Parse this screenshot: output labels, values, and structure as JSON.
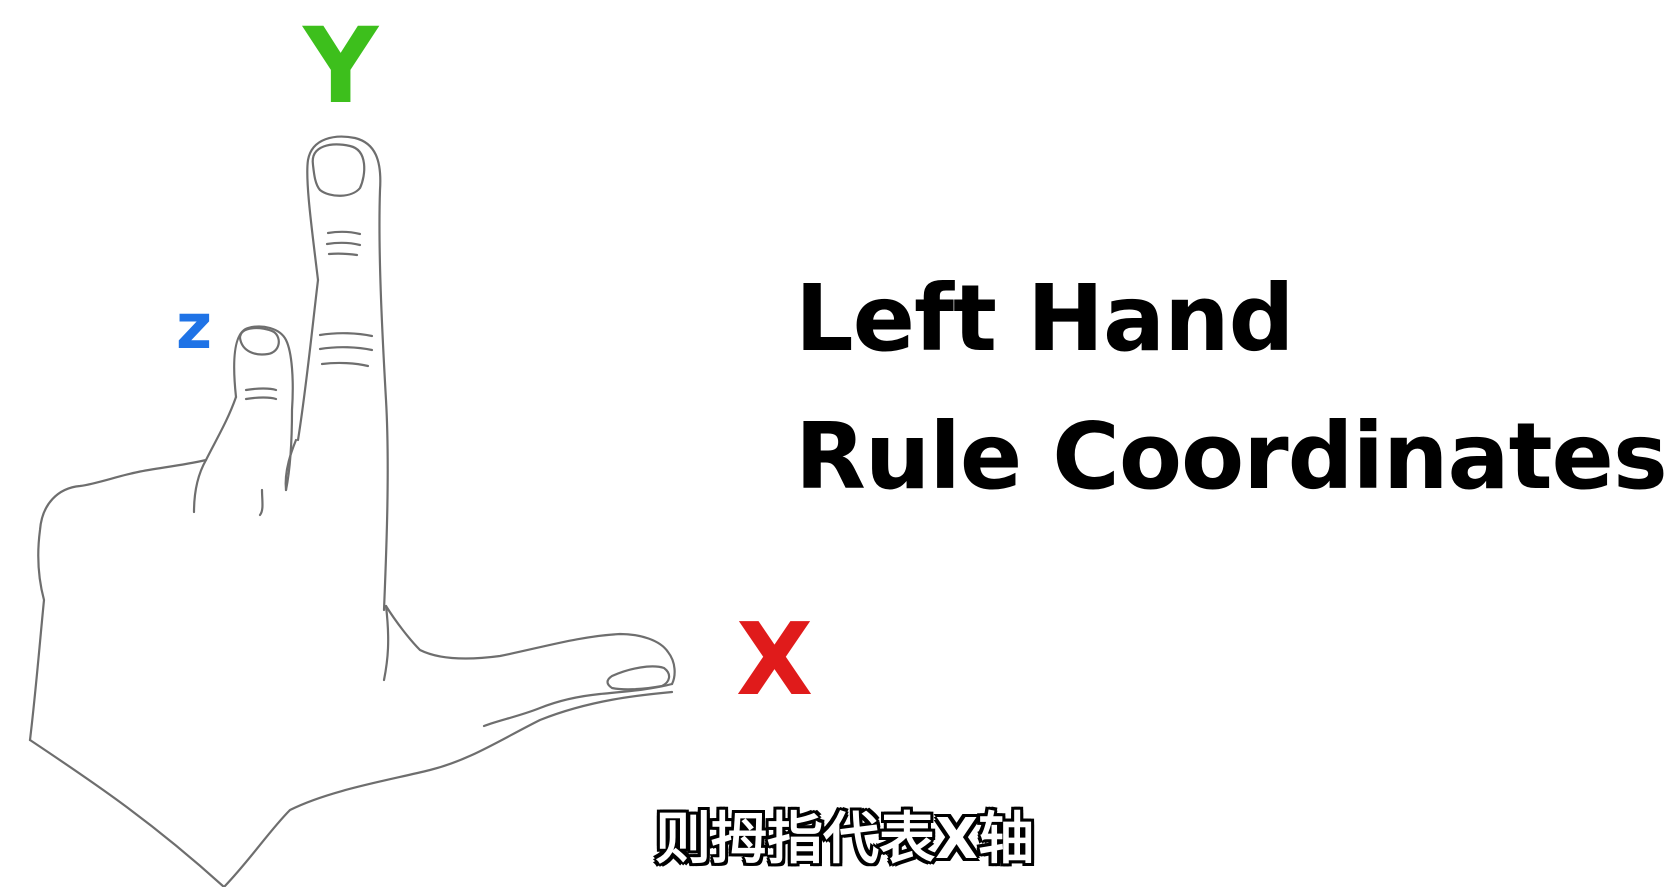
{
  "axes": {
    "y": {
      "label": "Y",
      "color": "#3dbf1c"
    },
    "z": {
      "label": "z",
      "color": "#1f73e6"
    },
    "x": {
      "label": "X",
      "color": "#e01b1b"
    }
  },
  "title": {
    "line1": "Left Hand",
    "line2": "Rule Coordinates"
  },
  "subtitle": "则拇指代表X轴",
  "colors": {
    "hand_outline": "#6e6e6e",
    "background": "#ffffff",
    "title_text": "#000000"
  },
  "icons": {
    "hand": "left-hand-outline-icon"
  }
}
